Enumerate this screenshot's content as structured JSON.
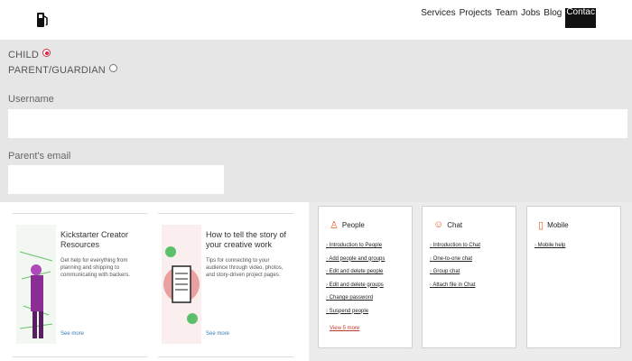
{
  "nav": {
    "items": [
      "Services",
      "Projects",
      "Team",
      "Jobs",
      "Blog"
    ],
    "contact": "Contac"
  },
  "form": {
    "role_child": "CHILD",
    "role_parent": "PARENT/GUARDIAN",
    "username_label": "Username",
    "username_value": "",
    "email_label": "Parent's email",
    "email_value": ""
  },
  "cards": [
    {
      "title": "Kickstarter Creator Resources",
      "desc": "Get help for everything from planning and shipping to communicating with backers.",
      "more": "See more"
    },
    {
      "title": "How to tell the story of your creative work",
      "desc": "Tips for connecting to your audience through video, photos, and story-driven project pages.",
      "more": "See more"
    }
  ],
  "help": [
    {
      "title": "People",
      "icon": "people-icon",
      "links": [
        "Introduction to People",
        "Add people and groups",
        "Edit and delete people",
        "Edit and delete groups",
        "Change password",
        "Suspend people"
      ],
      "view_more": "View 5 more"
    },
    {
      "title": "Chat",
      "icon": "chat-icon",
      "links": [
        "Introduction to Chat",
        "One-to-one chat",
        "Group chat",
        "Attach file in Chat"
      ]
    },
    {
      "title": "Mobile",
      "icon": "mobile-icon",
      "links": [
        "Mobile help"
      ]
    }
  ],
  "colors": {
    "accent": "#d42c44",
    "link": "#c0392b",
    "help_icon": "#e0602a"
  }
}
